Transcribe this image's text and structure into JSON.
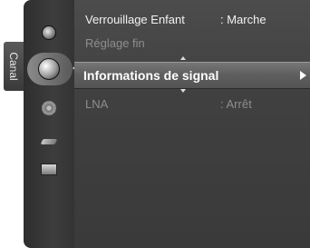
{
  "category_tab": {
    "label": "Canal"
  },
  "menu": {
    "items": [
      {
        "label": "Verrouillage Enfant",
        "value": ": Marche"
      },
      {
        "label": "Réglage fin",
        "value": ""
      },
      {
        "label": "Informations de signal",
        "value": ""
      },
      {
        "label": "LNA",
        "value": ": Arrêt"
      }
    ],
    "selected_index": 2
  },
  "icons": [
    "picture-icon",
    "channel-icon",
    "setup-icon",
    "input-icon",
    "application-icon"
  ]
}
